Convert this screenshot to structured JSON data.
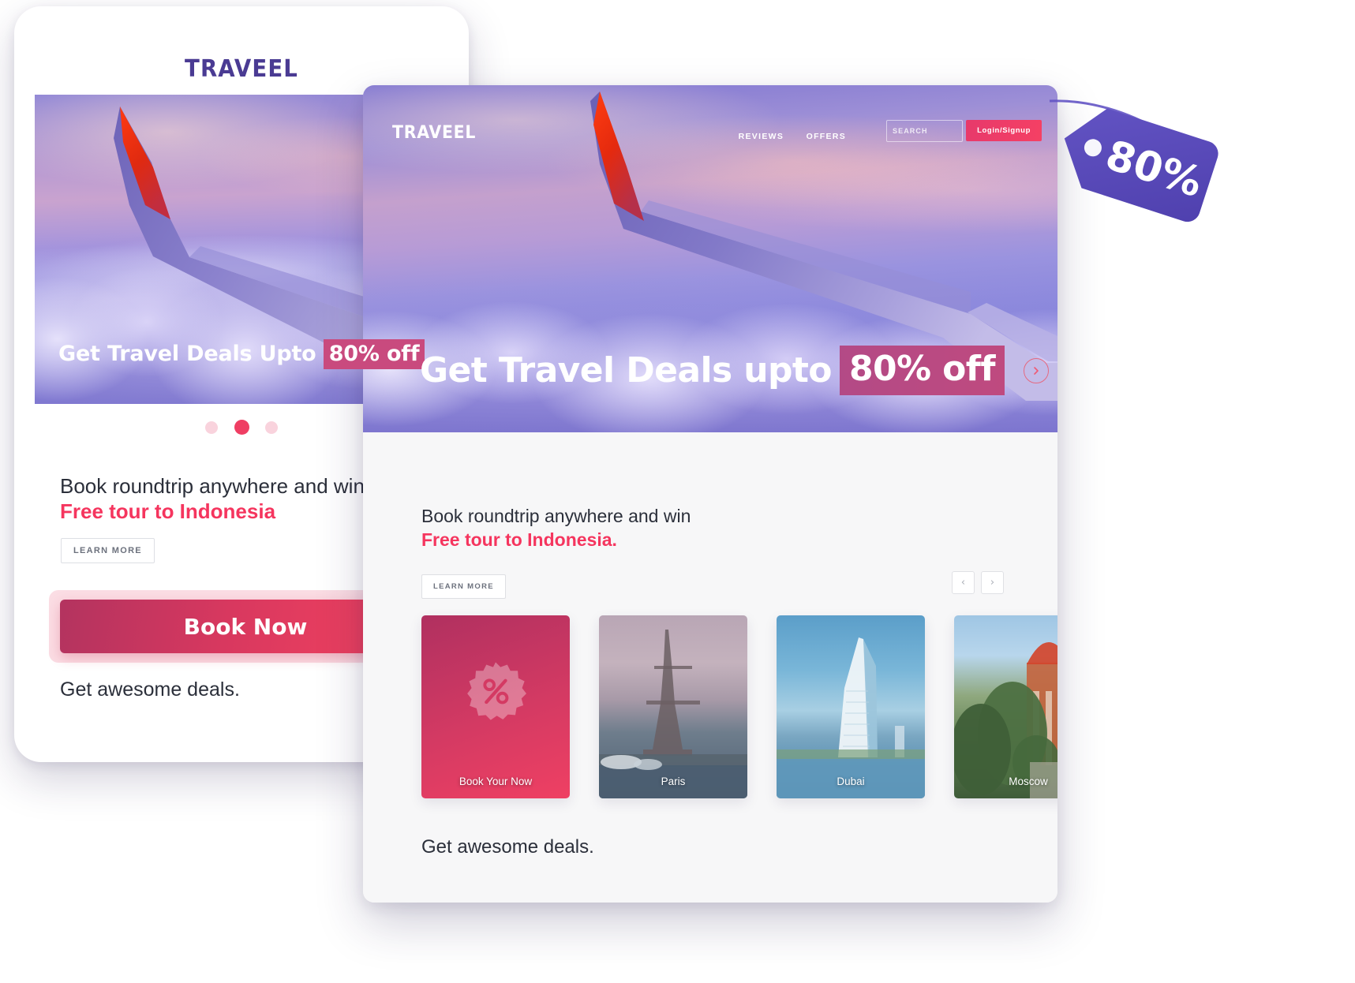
{
  "brand": {
    "name": "TRAVEEL",
    "purple": "#4a3b93",
    "pink": "#f5355e"
  },
  "mobile": {
    "logo": "TRAVEEL",
    "hero_title_plain": "Get Travel Deals Upto ",
    "hero_title_highlight": "80% off",
    "carousel_dots": 3,
    "active_dot_index": 1,
    "promo_line1": "Book roundtrip anywhere and win",
    "promo_line2": "Free tour to Indonesia",
    "learn_more_label": "LEARN MORE",
    "book_now_label": "Book Now",
    "deals_text": "Get awesome deals."
  },
  "desktop": {
    "logo": "TRAVEEL",
    "nav_links": [
      {
        "label": "REVIEWS"
      },
      {
        "label": "OFFERS"
      }
    ],
    "search": {
      "placeholder": "SEARCH",
      "value": ""
    },
    "login_label": "Login/Signup",
    "hero_title_plain": "Get Travel Deals upto",
    "hero_title_highlight": "80% off",
    "promo_line1": "Book roundtrip anywhere and win",
    "promo_line2": "Free tour to Indonesia.",
    "learn_more_label": "LEARN MORE",
    "carousel_prev": "‹",
    "carousel_next": "›",
    "cards": [
      {
        "type": "promo",
        "label": "Book Your Now",
        "icon": "percent-badge-icon"
      },
      {
        "type": "destination",
        "label": "Paris"
      },
      {
        "type": "destination",
        "label": "Dubai"
      },
      {
        "type": "destination",
        "label": "Moscow"
      }
    ],
    "deals_text": "Get awesome deals."
  },
  "price_tag": {
    "value": "80%",
    "color": "#5b4bbd"
  }
}
